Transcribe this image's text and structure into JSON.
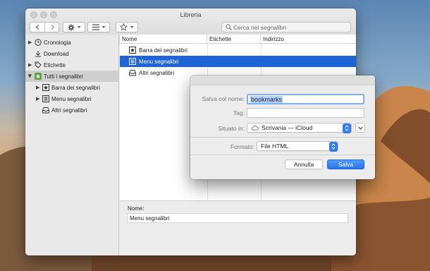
{
  "window": {
    "title": "Libreria"
  },
  "toolbar": {
    "search_placeholder": "Cerca nei segnalibri"
  },
  "sidebar": {
    "items": [
      {
        "label": "Cronologia",
        "icon": "clock-icon"
      },
      {
        "label": "Download",
        "icon": "download-icon"
      },
      {
        "label": "Etichette",
        "icon": "tag-icon"
      },
      {
        "label": "Tutti i segnalibri",
        "icon": "star-folder-icon",
        "selected": true
      },
      {
        "label": "Barra dei segnalibri",
        "icon": "star-box-icon"
      },
      {
        "label": "Menu segnalibri",
        "icon": "menu-list-icon"
      },
      {
        "label": "Altri segnalibri",
        "icon": "tray-icon"
      }
    ]
  },
  "table": {
    "columns": [
      "Nome",
      "Etichette",
      "Indirizzo"
    ],
    "rows": [
      {
        "name": "Barra dei segnalibri",
        "icon": "star-box-icon"
      },
      {
        "name": "Menu segnalibri",
        "icon": "menu-list-icon",
        "selected": true
      },
      {
        "name": "Altri segnalibri",
        "icon": "tray-icon"
      }
    ]
  },
  "details": {
    "name_label": "Nome:",
    "name_value": "Menu segnalibri"
  },
  "save_dialog": {
    "save_as_label": "Salva col nome:",
    "save_as_value": "bookmarks",
    "tags_label": "Tag:",
    "tags_value": "",
    "where_label": "Situato in:",
    "where_value": "Scrivania — iCloud",
    "format_label": "Formato:",
    "format_value": "File HTML",
    "cancel_label": "Annulla",
    "save_label": "Salva"
  },
  "colors": {
    "selection": "#1e66d8",
    "accent": "#2f7cf6"
  }
}
